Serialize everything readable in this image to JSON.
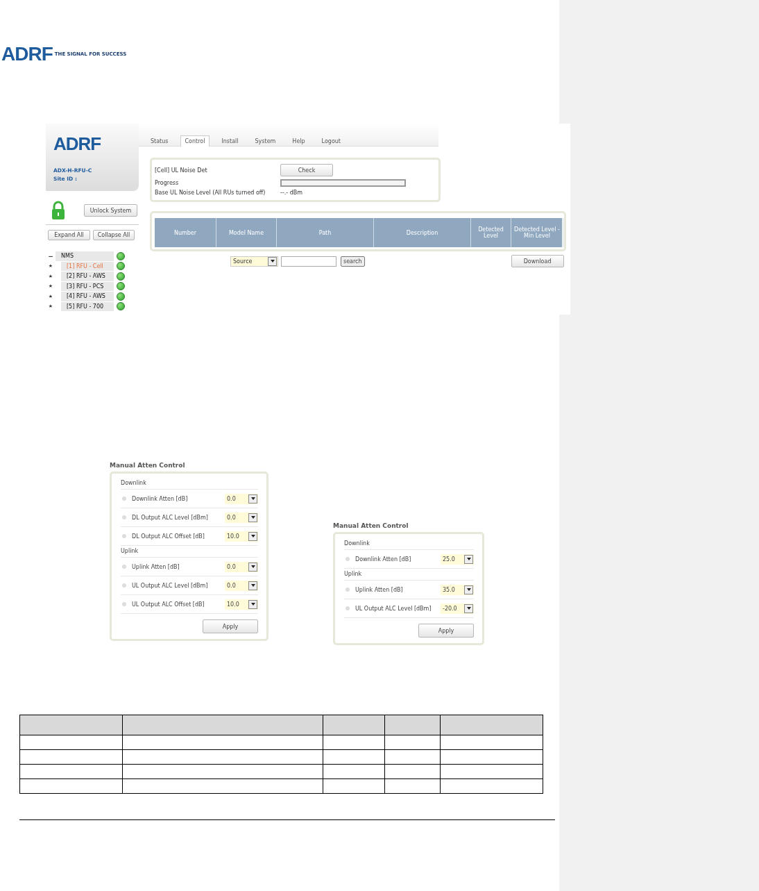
{
  "header": {
    "logo": "ADRF",
    "tagline": "THE SIGNAL FOR SUCCESS"
  },
  "web_ui": {
    "sidebar": {
      "logo": "ADRF",
      "model": "ADX-H-RFU-C",
      "site_id": "Site ID :",
      "locked": true,
      "unlock_button": "Unlock System",
      "expand_button": "Expand All",
      "collapse_button": "Collapse All",
      "tree": [
        {
          "toggle": "−",
          "label": "NMS",
          "selected": false,
          "children": [
            {
              "marker": "★",
              "label": "[1] RFU - Cell",
              "selected": true
            },
            {
              "marker": "★",
              "label": "[2] RFU - AWS",
              "selected": false
            },
            {
              "marker": "★",
              "label": "[3] RFU - PCS",
              "selected": false
            },
            {
              "marker": "★",
              "label": "[4] RFU - AWS",
              "selected": false
            },
            {
              "marker": "★",
              "label": "[5] RFU - 700",
              "selected": false
            }
          ]
        }
      ]
    },
    "tabs": [
      {
        "label": "Status",
        "selected": false
      },
      {
        "label": "Control",
        "selected": true
      },
      {
        "label": "Install",
        "selected": false
      },
      {
        "label": "System",
        "selected": false
      },
      {
        "label": "Help",
        "selected": false
      },
      {
        "label": "Logout",
        "selected": false
      }
    ],
    "noise_panel": {
      "title": "[Cell] UL Noise Det",
      "check_button": "Check",
      "progress_label": "Progress",
      "progress": {
        "level": 0
      },
      "base_label": "Base UL Noise Level (All RUs turned off)",
      "base_value": "--.- dBm"
    },
    "result_table": {
      "columns": [
        "Number",
        "Model Name",
        "Path",
        "Description",
        "Detected Level",
        "Detected Level - Min Level"
      ]
    },
    "search": {
      "source": "Source",
      "button": "search",
      "download_button": "Download"
    }
  },
  "atten_panels": [
    {
      "title": "Manual Atten Control",
      "groups": [
        {
          "label": "Downlink",
          "rows": [
            {
              "label": "Downlink Atten [dB]",
              "value": "0.0"
            },
            {
              "label": "DL Output ALC Level [dBm]",
              "value": "0.0"
            },
            {
              "label": "DL Output ALC Offset [dB]",
              "value": "10.0"
            }
          ]
        },
        {
          "label": "Uplink",
          "rows": [
            {
              "label": "Uplink Atten [dB]",
              "value": "0.0"
            },
            {
              "label": "UL Output ALC Level [dBm]",
              "value": "0.0"
            },
            {
              "label": "UL Output ALC Offset [dB]",
              "value": "10.0"
            }
          ]
        }
      ],
      "apply_button": "Apply"
    },
    {
      "title": "Manual Atten Control",
      "groups": [
        {
          "label": "Downlink",
          "rows": [
            {
              "label": "Downlink Atten [dB]",
              "value": "25.0"
            }
          ]
        },
        {
          "label": "Uplink",
          "rows": [
            {
              "label": "Uplink Atten [dB]",
              "value": "35.0"
            },
            {
              "label": "UL Output ALC Level [dBm]",
              "value": "-20.0"
            }
          ]
        }
      ],
      "apply_button": "Apply"
    }
  ]
}
